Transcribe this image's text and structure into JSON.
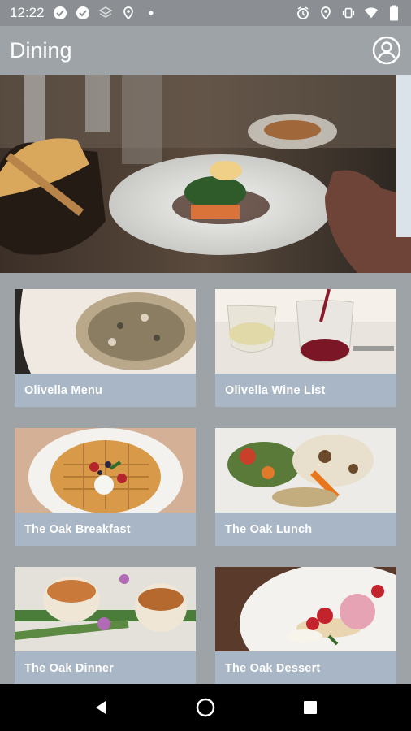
{
  "status_bar": {
    "time": "12:22",
    "icons_left": [
      "check-circle-icon",
      "check-circle-icon",
      "layers-icon",
      "location-pin-icon",
      "dot-icon"
    ],
    "icons_right": [
      "alarm-icon",
      "location-icon",
      "vibrate-icon",
      "wifi-icon",
      "battery-icon"
    ]
  },
  "app_bar": {
    "title": "Dining",
    "account_icon": "account-circle-icon"
  },
  "hero": {
    "image": "restaurant-table-photo"
  },
  "cards": [
    {
      "label": "Olivella Menu",
      "image": "risotto-photo"
    },
    {
      "label": "Olivella Wine List",
      "image": "wine-glasses-photo"
    },
    {
      "label": "The Oak Breakfast",
      "image": "waffle-photo"
    },
    {
      "label": "The Oak Lunch",
      "image": "cauliflower-salad-photo"
    },
    {
      "label": "The Oak Dinner",
      "image": "scallops-photo"
    },
    {
      "label": "The Oak Dessert",
      "image": "dessert-photo"
    }
  ],
  "nav_bar": {
    "buttons": [
      "back-icon",
      "home-icon",
      "recents-icon"
    ]
  },
  "colors": {
    "app_bar": "#9ea3a8",
    "status_bar": "#8b8f93",
    "card_label": "#a9b6c5",
    "nav_bar": "#000000"
  }
}
